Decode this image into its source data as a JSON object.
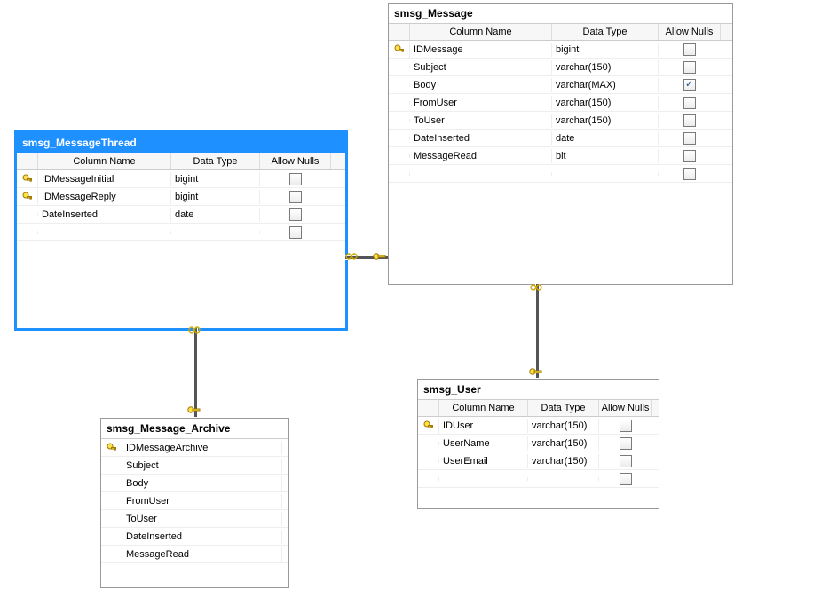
{
  "headers": {
    "name": "Column Name",
    "type": "Data Type",
    "nulls": "Allow Nulls"
  },
  "tables": {
    "message": {
      "title": "smsg_Message",
      "name_w": 160,
      "type_w": 120,
      "null_w": 70,
      "show_type": true,
      "show_null": true,
      "columns": [
        {
          "key": true,
          "name": "IDMessage",
          "type": "bigint",
          "null": false
        },
        {
          "key": false,
          "name": "Subject",
          "type": "varchar(150)",
          "null": false
        },
        {
          "key": false,
          "name": "Body",
          "type": "varchar(MAX)",
          "null": true
        },
        {
          "key": false,
          "name": "FromUser",
          "type": "varchar(150)",
          "null": false
        },
        {
          "key": false,
          "name": "ToUser",
          "type": "varchar(150)",
          "null": false
        },
        {
          "key": false,
          "name": "DateInserted",
          "type": "date",
          "null": false
        },
        {
          "key": false,
          "name": "MessageRead",
          "type": "bit",
          "null": false
        },
        {
          "key": false,
          "name": "",
          "type": "",
          "null": false
        }
      ]
    },
    "thread": {
      "title": "smsg_MessageThread",
      "name_w": 150,
      "type_w": 100,
      "null_w": 80,
      "show_type": true,
      "show_null": true,
      "columns": [
        {
          "key": true,
          "name": "IDMessageInitial",
          "type": "bigint",
          "null": false
        },
        {
          "key": true,
          "name": "IDMessageReply",
          "type": "bigint",
          "null": false
        },
        {
          "key": false,
          "name": "DateInserted",
          "type": "date",
          "null": false
        },
        {
          "key": false,
          "name": "",
          "type": "",
          "null": false
        }
      ]
    },
    "archive": {
      "title": "smsg_Message_Archive",
      "name_w": 180,
      "type_w": 0,
      "null_w": 0,
      "show_type": false,
      "show_null": false,
      "columns": [
        {
          "key": true,
          "name": "IDMessageArchive"
        },
        {
          "key": false,
          "name": "Subject"
        },
        {
          "key": false,
          "name": "Body"
        },
        {
          "key": false,
          "name": "FromUser"
        },
        {
          "key": false,
          "name": "ToUser"
        },
        {
          "key": false,
          "name": "DateInserted"
        },
        {
          "key": false,
          "name": "MessageRead"
        }
      ]
    },
    "user": {
      "title": "smsg_User",
      "name_w": 100,
      "type_w": 80,
      "null_w": 60,
      "show_type": true,
      "show_null": true,
      "columns": [
        {
          "key": true,
          "name": "IDUser",
          "type": "varchar(150)",
          "null": false
        },
        {
          "key": false,
          "name": "UserName",
          "type": "varchar(150)",
          "null": false
        },
        {
          "key": false,
          "name": "UserEmail",
          "type": "varchar(150)",
          "null": false
        },
        {
          "key": false,
          "name": "",
          "type": "",
          "null": false
        }
      ]
    }
  }
}
